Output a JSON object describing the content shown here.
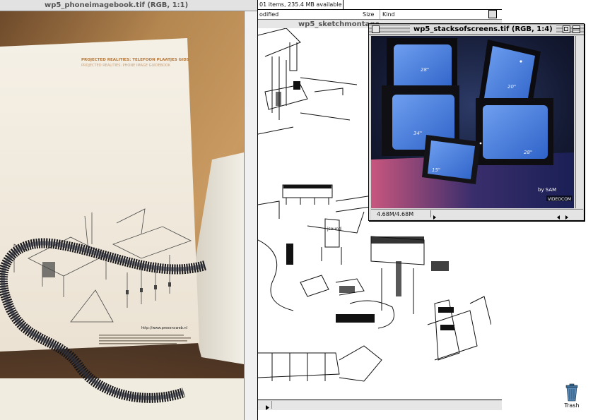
{
  "windows": {
    "phone": {
      "title": "wp5_phoneimagebook.tif  (RGB, 1:1)"
    },
    "finder": {
      "info": "01 items, 235.4 MB available",
      "col_modified": "odified",
      "col_size": "Size",
      "col_kind": "Kind"
    },
    "sketch": {
      "title": "wp5_sketchmontage"
    },
    "stacks": {
      "title": "wp5_stacksofscreens.tif  (RGB, 1:4)",
      "size_readout": "4.68M/4.68M"
    }
  },
  "document": {
    "heading": "PROJECTED REALITIES: TELEFOON PLAATJES GIDS",
    "subheading": "PROJECTED REALITIES: PHONE IMAGE GUIDEBOOK",
    "url": "http://www.presencweb.nl"
  },
  "photo": {
    "screen_sizes": [
      "28\"",
      "20\"",
      "34\"",
      "28\"",
      "15\""
    ],
    "logo_top": "by SAM",
    "logo_bottom": "VIDEOCOM"
  },
  "sketch_labels": {
    "sign": "jsound"
  },
  "desktop": {
    "trash_label": "Trash"
  },
  "icons": [
    "close-box-icon",
    "zoom-box-icon",
    "collapse-box-icon",
    "scroll-arrow-right-icon",
    "scroll-arrow-left-icon",
    "trash-icon"
  ]
}
